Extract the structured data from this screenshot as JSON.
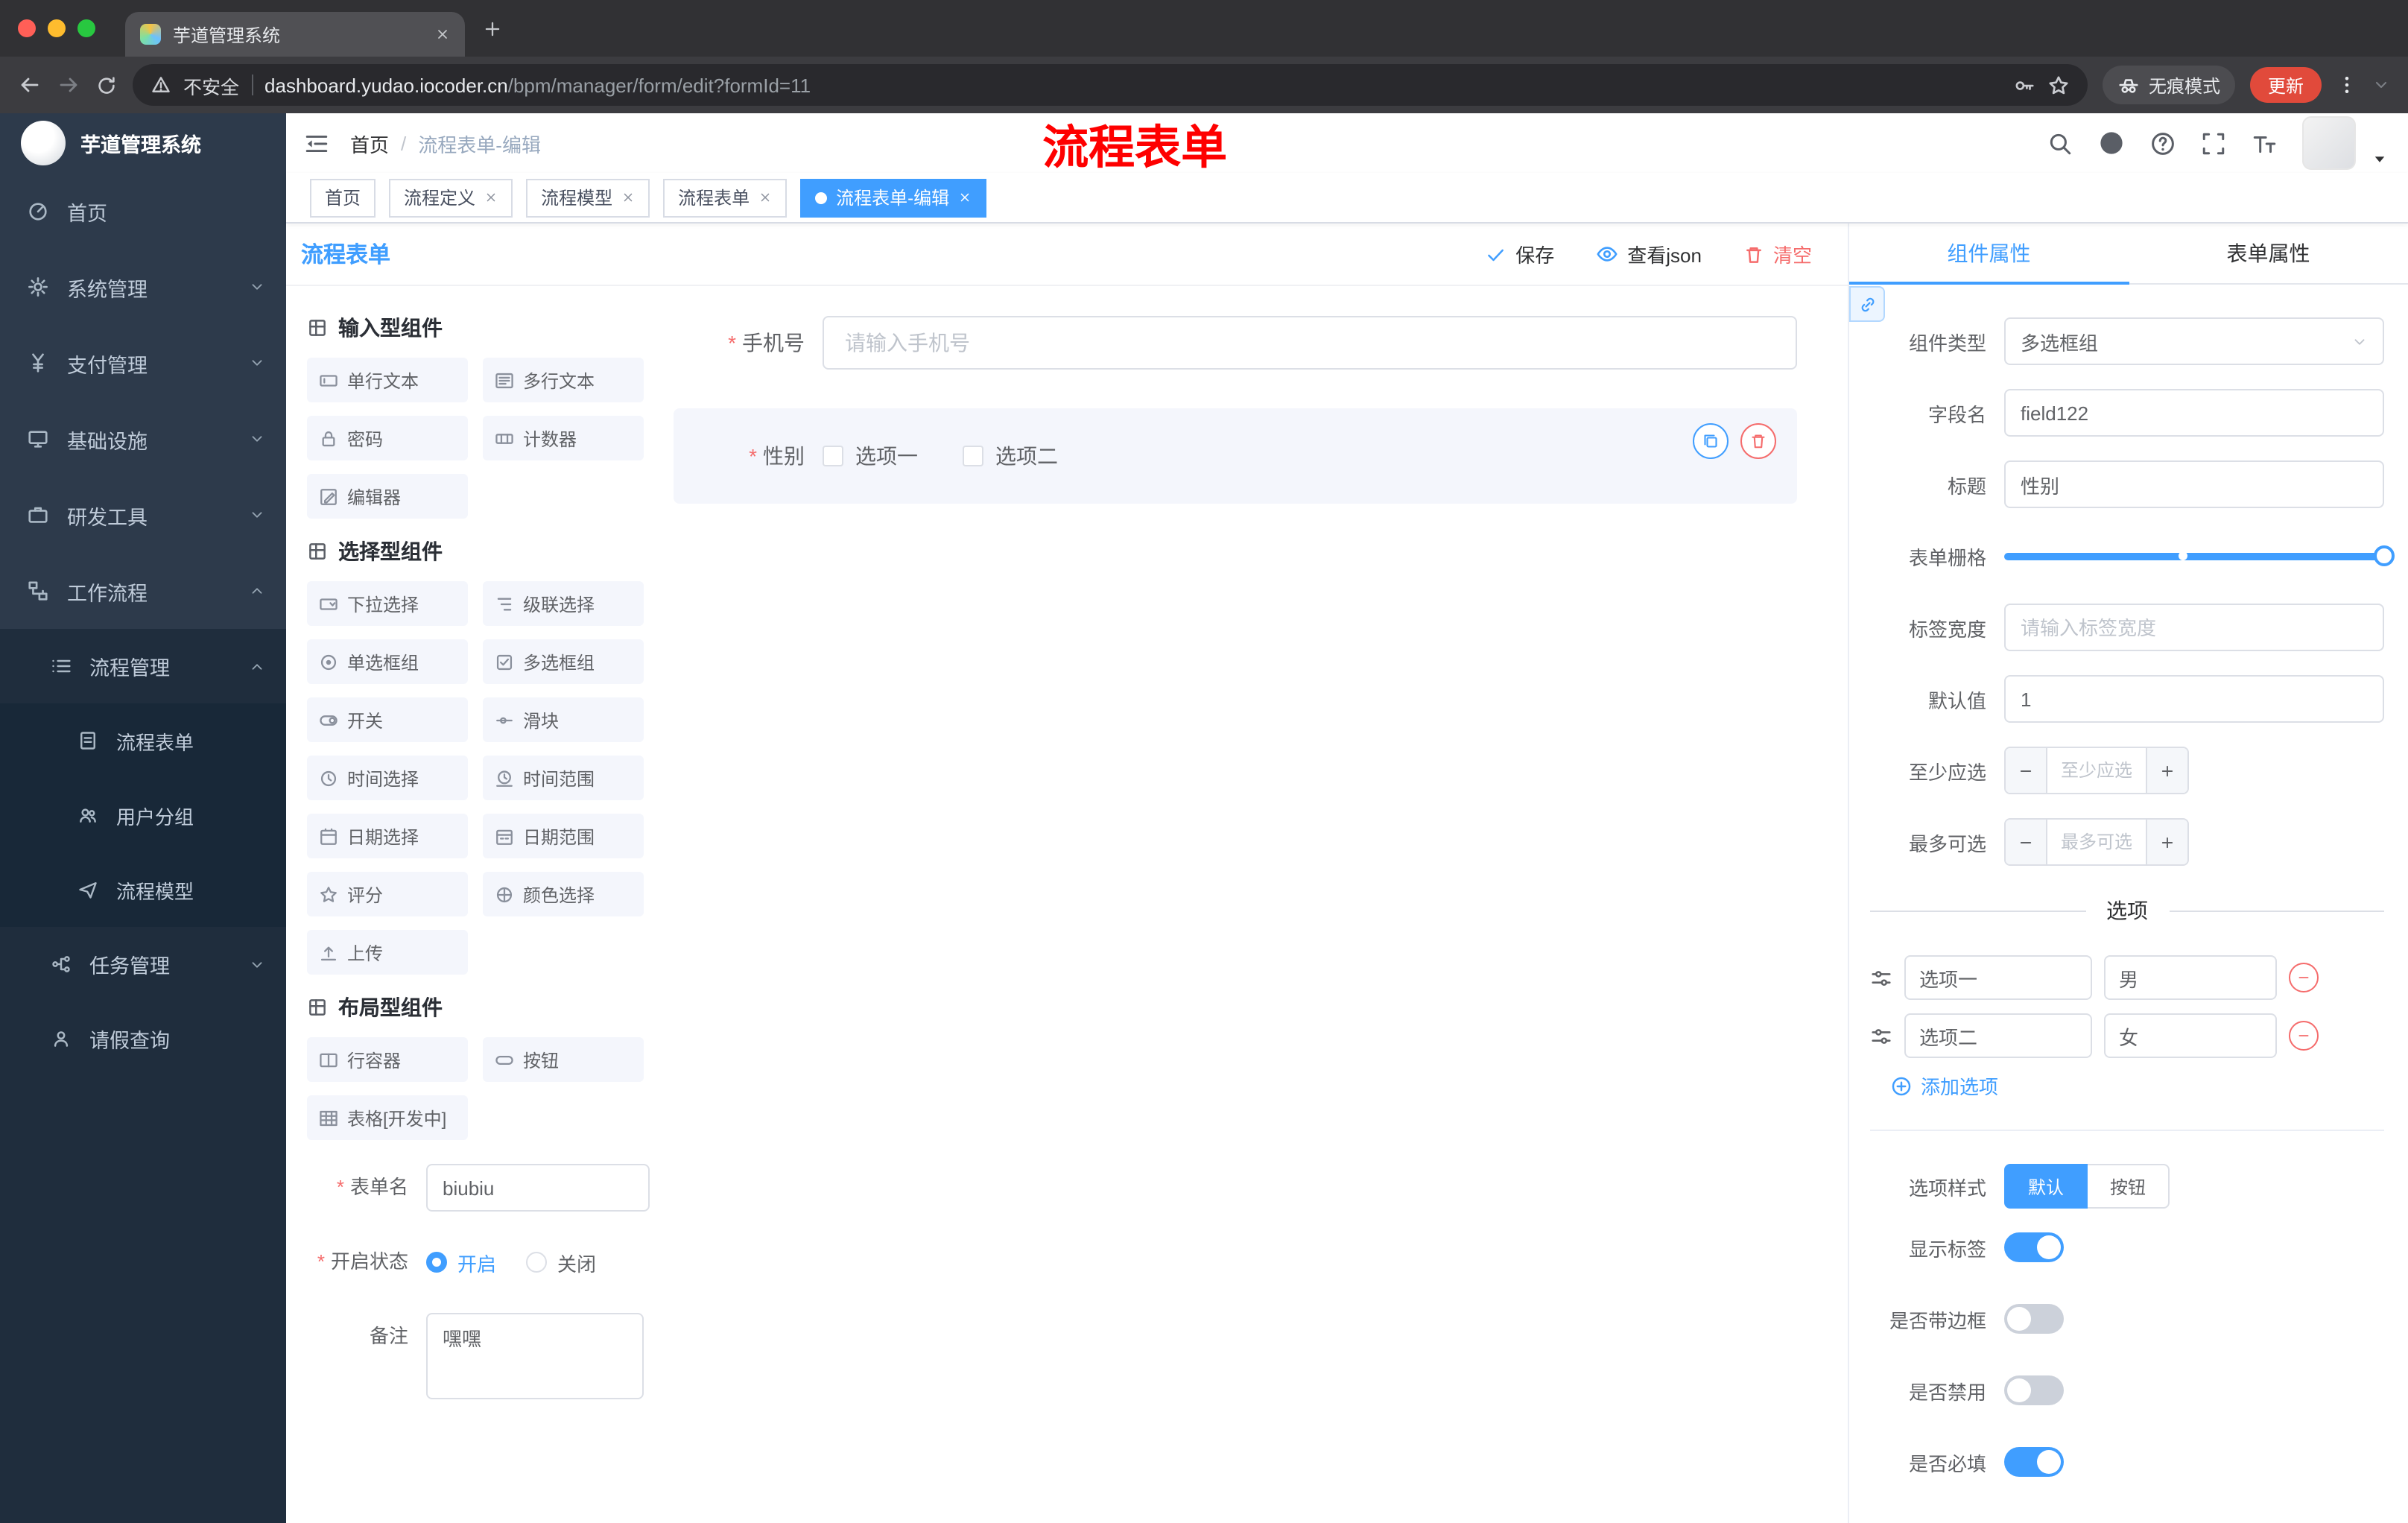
{
  "browser": {
    "tab_title": "芋道管理系统",
    "security_label": "不安全",
    "url_host": "dashboard.yudao.iocoder.cn",
    "url_path": "/bpm/manager/form/edit?formId=11",
    "incognito_label": "无痕模式",
    "update_label": "更新"
  },
  "sidebar": {
    "app_title": "芋道管理系统",
    "menu": [
      {
        "label": "首页",
        "icon": "dashboard-icon"
      },
      {
        "label": "系统管理",
        "icon": "settings-icon"
      },
      {
        "label": "支付管理",
        "icon": "payment-icon"
      },
      {
        "label": "基础设施",
        "icon": "infrastructure-icon"
      },
      {
        "label": "研发工具",
        "icon": "devtools-icon"
      },
      {
        "label": "工作流程",
        "icon": "workflow-icon"
      },
      {
        "label": "流程管理",
        "icon": "process-management-icon"
      },
      {
        "label": "流程表单",
        "icon": "process-form-icon"
      },
      {
        "label": "用户分组",
        "icon": "user-group-icon"
      },
      {
        "label": "流程模型",
        "icon": "process-model-icon"
      },
      {
        "label": "任务管理",
        "icon": "task-management-icon"
      },
      {
        "label": "请假查询",
        "icon": "leave-query-icon"
      }
    ]
  },
  "header": {
    "breadcrumb_home": "首页",
    "breadcrumb_current": "流程表单-编辑",
    "annotation": "流程表单"
  },
  "tags": [
    {
      "label": "首页"
    },
    {
      "label": "流程定义"
    },
    {
      "label": "流程模型"
    },
    {
      "label": "流程表单"
    },
    {
      "label": "流程表单-编辑"
    }
  ],
  "designer": {
    "title": "流程表单",
    "save_label": "保存",
    "view_json_label": "查看json",
    "clear_label": "清空"
  },
  "palette": {
    "groups": [
      {
        "title": "输入型组件",
        "items": [
          {
            "label": "单行文本",
            "icon": "single-text-icon"
          },
          {
            "label": "多行文本",
            "icon": "multi-text-icon"
          },
          {
            "label": "密码",
            "icon": "password-icon"
          },
          {
            "label": "计数器",
            "icon": "counter-icon"
          },
          {
            "label": "编辑器",
            "icon": "editor-icon"
          }
        ]
      },
      {
        "title": "选择型组件",
        "items": [
          {
            "label": "下拉选择",
            "icon": "select-icon"
          },
          {
            "label": "级联选择",
            "icon": "cascader-icon"
          },
          {
            "label": "单选框组",
            "icon": "radio-group-icon"
          },
          {
            "label": "多选框组",
            "icon": "checkbox-group-icon"
          },
          {
            "label": "开关",
            "icon": "switch-icon"
          },
          {
            "label": "滑块",
            "icon": "slider-icon"
          },
          {
            "label": "时间选择",
            "icon": "time-picker-icon"
          },
          {
            "label": "时间范围",
            "icon": "time-range-icon"
          },
          {
            "label": "日期选择",
            "icon": "date-picker-icon"
          },
          {
            "label": "日期范围",
            "icon": "date-range-icon"
          },
          {
            "label": "评分",
            "icon": "rate-icon"
          },
          {
            "label": "颜色选择",
            "icon": "color-picker-icon"
          },
          {
            "label": "上传",
            "icon": "upload-icon"
          }
        ]
      },
      {
        "title": "布局型组件",
        "items": [
          {
            "label": "行容器",
            "icon": "row-container-icon"
          },
          {
            "label": "按钮",
            "icon": "button-icon"
          },
          {
            "label": "表格[开发中]",
            "icon": "table-icon"
          }
        ]
      }
    ]
  },
  "meta": {
    "form_name_label": "表单名",
    "form_name_value": "biubiu",
    "status_label": "开启状态",
    "status_on": "开启",
    "status_off": "关闭",
    "remark_label": "备注",
    "remark_value": "嘿嘿"
  },
  "canvas": {
    "phone_label": "手机号",
    "phone_placeholder": "请输入手机号",
    "gender_label": "性别",
    "gender_option1": "选项一",
    "gender_option2": "选项二"
  },
  "props": {
    "tab_component": "组件属性",
    "tab_form": "表单属性",
    "component_type_label": "组件类型",
    "component_type_value": "多选框组",
    "field_name_label": "字段名",
    "field_name_value": "field122",
    "title_label": "标题",
    "title_value": "性别",
    "grid_label": "表单栅格",
    "label_width_label": "标签宽度",
    "label_width_placeholder": "请输入标签宽度",
    "default_label": "默认值",
    "default_value": "1",
    "min_label": "至少应选",
    "min_placeholder": "至少应选",
    "max_label": "最多可选",
    "max_placeholder": "最多可选",
    "options_title": "选项",
    "options": [
      {
        "label": "选项一",
        "value": "男"
      },
      {
        "label": "选项二",
        "value": "女"
      }
    ],
    "add_option_label": "添加选项",
    "style_label": "选项样式",
    "style_default": "默认",
    "style_button": "按钮",
    "switch_show_label": "显示标签",
    "switch_border": "是否带边框",
    "switch_disabled": "是否禁用",
    "switch_required": "是否必填"
  },
  "colors": {
    "accent": "#409eff",
    "danger": "#f56c6c",
    "annotation_red": "#fe0000",
    "sidebar_bg": "#2d3a4b",
    "sidebar_sub_bg": "#1f2d3d"
  }
}
